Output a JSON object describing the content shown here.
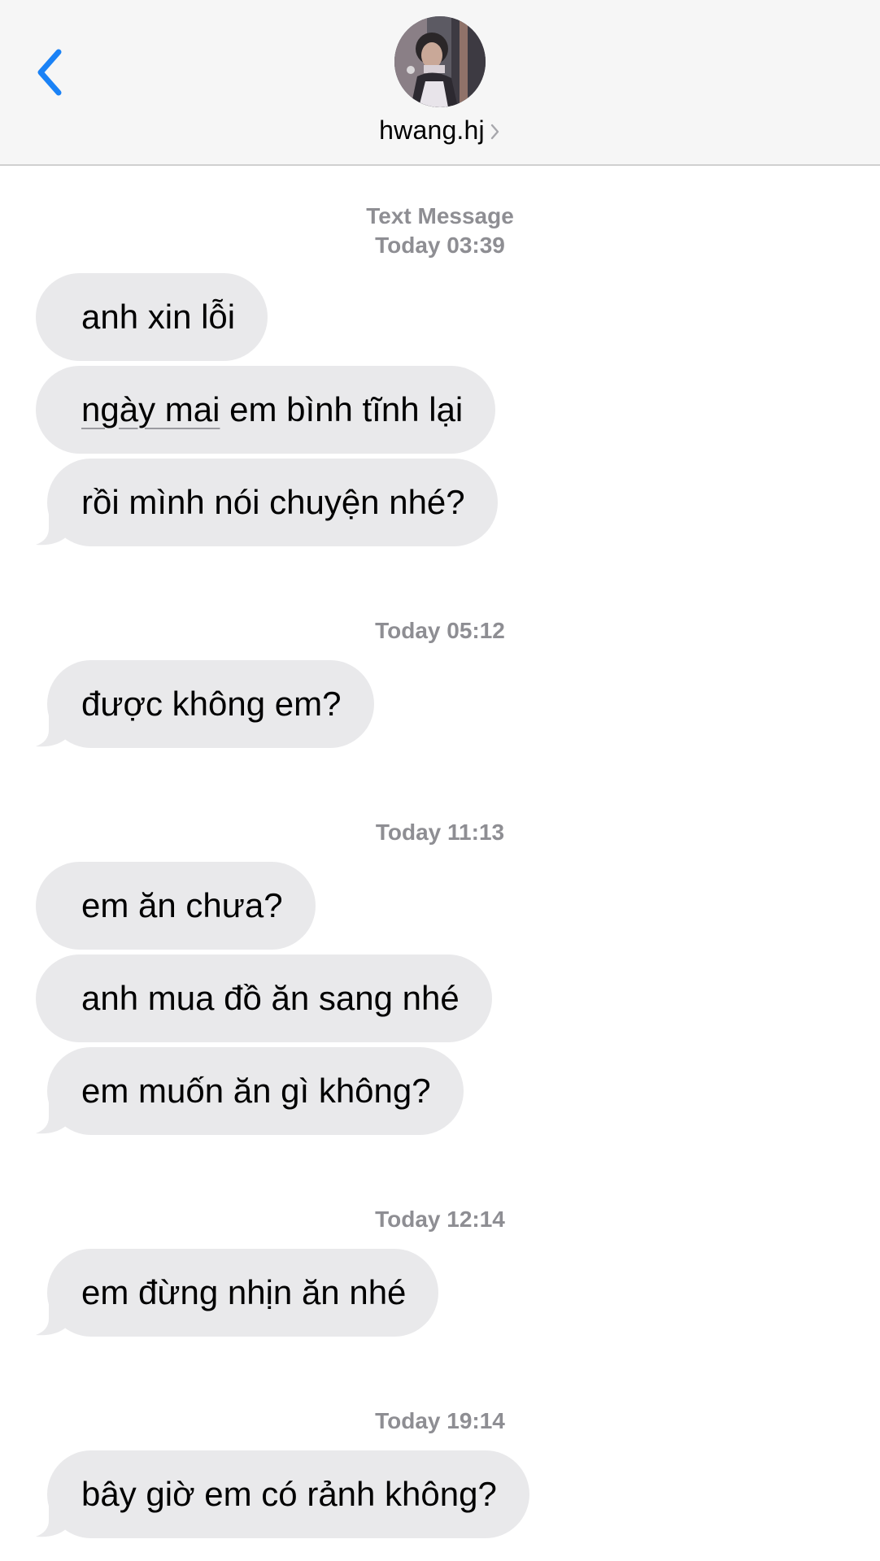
{
  "header": {
    "contact_name": "hwang.hj",
    "back_icon": "chevron-left-icon",
    "disclosure_icon": "chevron-right-icon"
  },
  "colors": {
    "accent": "#1a82f6",
    "received_bubble": "#e9e9eb",
    "timestamp": "#8e8e93",
    "header_bg": "#f6f6f6"
  },
  "thread": {
    "service_label": "Text Message",
    "groups": [
      {
        "timestamp": "Today 03:39",
        "messages": [
          "anh xin lỗi",
          "ngày mai em bình tĩnh lại",
          "rồi mình nói chuyện nhé?"
        ]
      },
      {
        "timestamp": "Today 05:12",
        "messages": [
          "được không em?"
        ]
      },
      {
        "timestamp": "Today 11:13",
        "messages": [
          "em ăn chưa?",
          "anh mua đồ ăn sang nhé",
          "em muốn ăn gì không?"
        ]
      },
      {
        "timestamp": "Today 12:14",
        "messages": [
          "em đừng nhịn ăn nhé"
        ]
      },
      {
        "timestamp": "Today 19:14",
        "messages": [
          "bây giờ em có rảnh không?"
        ]
      }
    ],
    "underlined_fragment": "ngày mai",
    "message_1_rest": " em bình tĩnh lại"
  }
}
